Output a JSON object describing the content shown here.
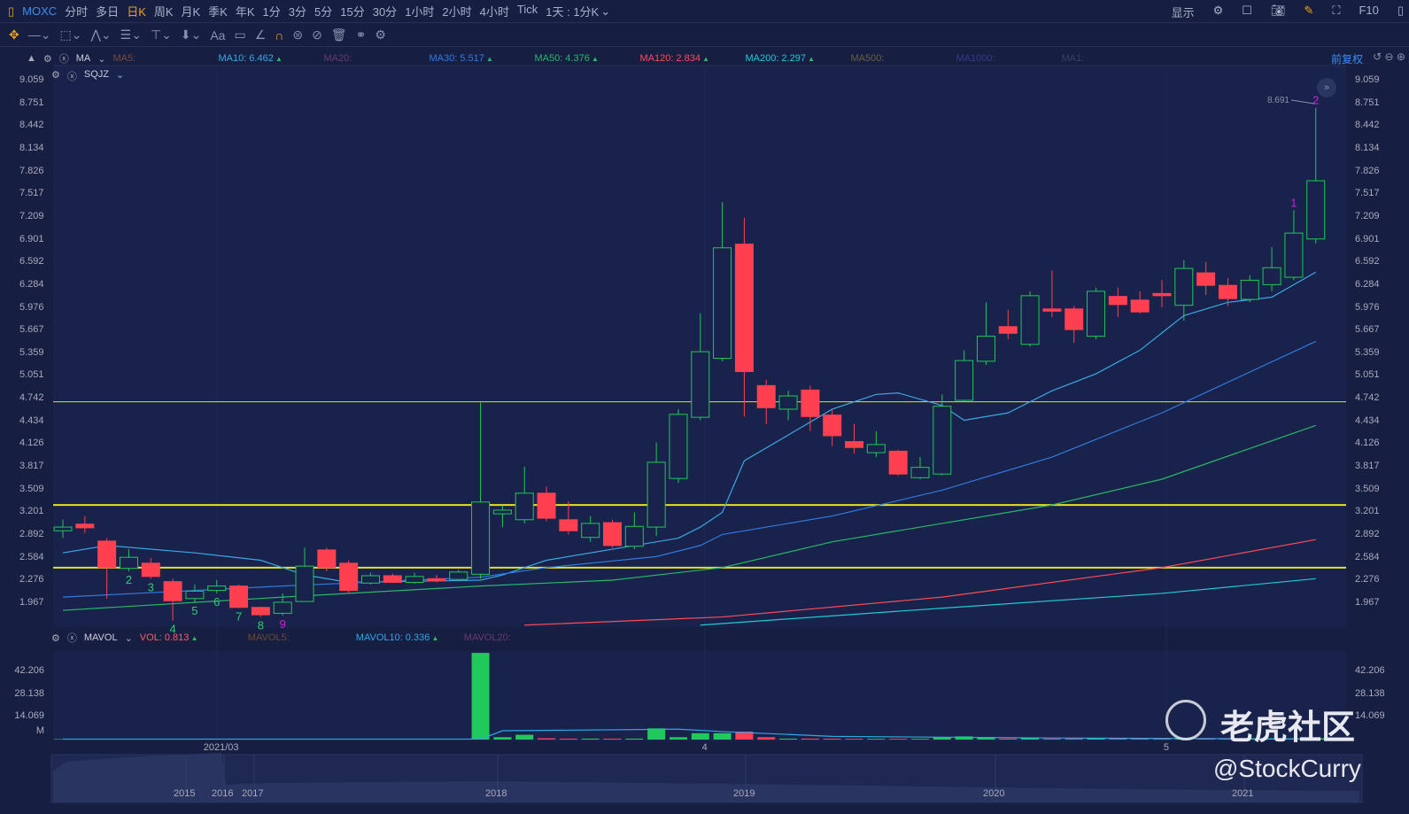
{
  "header": {
    "ticker": "MOXC",
    "periods": [
      "分时",
      "多日",
      "日K",
      "周K",
      "月K",
      "季K",
      "年K",
      "1分",
      "3分",
      "5分",
      "15分",
      "30分",
      "1小时",
      "2小时",
      "4小时",
      "Tick"
    ],
    "active_period": "日K",
    "interval": "1天 : 1分K",
    "display": "显示",
    "f10": "F10"
  },
  "toolbar": {
    "icons": [
      "move-icon",
      "line-icon",
      "rect-icon",
      "wave-icon",
      "fib-icon",
      "measure-icon",
      "arrow-down-icon",
      "text-icon",
      "comment-icon",
      "angle-icon",
      "magnet-icon",
      "lock-icon",
      "hide-icon",
      "trash-icon",
      "compare-icon",
      "settings-icon"
    ],
    "text_tool": "Aa"
  },
  "indicators": {
    "ma": {
      "name": "MA",
      "items": [
        {
          "label": "MA5:",
          "value": "",
          "color": "#7a4a3a"
        },
        {
          "label": "MA10:",
          "value": "6.462",
          "color": "#3aa8e6"
        },
        {
          "label": "MA20:",
          "value": "",
          "color": "#6a3a6a"
        },
        {
          "label": "MA30:",
          "value": "5.517",
          "color": "#2f7be0"
        },
        {
          "label": "MA50:",
          "value": "4.376",
          "color": "#27b86a"
        },
        {
          "label": "MA120:",
          "value": "2.834",
          "color": "#ff4a5a"
        },
        {
          "label": "MA200:",
          "value": "2.297",
          "color": "#22c8d8"
        },
        {
          "label": "MA500:",
          "value": "",
          "color": "#6a6040"
        },
        {
          "label": "MA1000:",
          "value": "",
          "color": "#3a3a8a"
        },
        {
          "label": "MA1:",
          "value": "",
          "color": "#3a4060"
        }
      ]
    },
    "sqjz": {
      "name": "SQJZ"
    },
    "adj": "前复权",
    "mavol": {
      "name": "MAVOL",
      "items": [
        {
          "label": "VOL:",
          "value": "0.813",
          "color": "#ff5a6a"
        },
        {
          "label": "MAVOL5:",
          "value": "",
          "color": "#6a4a3a"
        },
        {
          "label": "MAVOL10:",
          "value": "0.336",
          "color": "#2fa8e8"
        },
        {
          "label": "MAVOL20:",
          "value": "",
          "color": "#6a3a6a"
        }
      ]
    }
  },
  "price_axis": [
    "9.059",
    "8.751",
    "8.442",
    "8.134",
    "7.826",
    "7.517",
    "7.209",
    "6.901",
    "6.592",
    "6.284",
    "5.976",
    "5.667",
    "5.359",
    "5.051",
    "4.742",
    "4.434",
    "4.126",
    "3.817",
    "3.509",
    "3.201",
    "2.892",
    "2.584",
    "2.276",
    "1.967"
  ],
  "vol_axis": [
    "42.206",
    "28.138",
    "14.069",
    "M"
  ],
  "time_axis": [
    {
      "label": "2021/03",
      "i": 7
    },
    {
      "label": "4",
      "i": 29.2
    },
    {
      "label": "5",
      "i": 50.2
    }
  ],
  "navigator_years": [
    "2015",
    "2016",
    "2017",
    "2018",
    "2019",
    "2020",
    "2021"
  ],
  "high_label": "8.691",
  "watermark": "老虎社区",
  "author": "@StockCurry",
  "chart_data": {
    "type": "candlestick",
    "price_range": [
      1.967,
      9.059
    ],
    "vol_range": [
      0,
      56.27
    ],
    "candles_ochl": [
      [
        2.95,
        3.0,
        3.1,
        2.85
      ],
      [
        3.04,
        2.99,
        3.15,
        2.92
      ],
      [
        2.81,
        2.45,
        2.85,
        2.03
      ],
      [
        2.44,
        2.59,
        2.7,
        2.4
      ],
      [
        2.51,
        2.33,
        2.58,
        2.3
      ],
      [
        2.26,
        2.0,
        2.3,
        1.73
      ],
      [
        2.03,
        2.13,
        2.22,
        1.98
      ],
      [
        2.14,
        2.2,
        2.28,
        2.1
      ],
      [
        2.2,
        1.91,
        2.22,
        1.9
      ],
      [
        1.91,
        1.81,
        1.92,
        1.78
      ],
      [
        1.83,
        1.98,
        2.1,
        1.8
      ],
      [
        1.99,
        2.47,
        2.72,
        1.99
      ],
      [
        2.69,
        2.45,
        2.72,
        2.4
      ],
      [
        2.51,
        2.14,
        2.55,
        2.1
      ],
      [
        2.24,
        2.34,
        2.38,
        2.22
      ],
      [
        2.34,
        2.25,
        2.37,
        2.24
      ],
      [
        2.25,
        2.33,
        2.38,
        2.23
      ],
      [
        2.3,
        2.27,
        2.35,
        2.25
      ],
      [
        2.29,
        2.39,
        2.42,
        2.27
      ],
      [
        2.36,
        3.34,
        4.69,
        2.3
      ],
      [
        3.18,
        3.23,
        3.3,
        3.0
      ],
      [
        3.1,
        3.46,
        3.82,
        3.05
      ],
      [
        3.46,
        3.12,
        3.55,
        3.08
      ],
      [
        3.1,
        2.95,
        3.35,
        2.9
      ],
      [
        2.86,
        3.05,
        3.15,
        2.8
      ],
      [
        3.06,
        2.75,
        3.1,
        2.72
      ],
      [
        2.74,
        3.01,
        3.2,
        2.7
      ],
      [
        3.0,
        3.88,
        4.15,
        2.88
      ],
      [
        3.66,
        4.53,
        4.6,
        3.6
      ],
      [
        4.49,
        5.38,
        5.9,
        4.45
      ],
      [
        5.29,
        6.79,
        7.41,
        5.25
      ],
      [
        6.84,
        5.11,
        7.2,
        4.5
      ],
      [
        4.92,
        4.62,
        5.0,
        4.4
      ],
      [
        4.6,
        4.78,
        4.85,
        4.45
      ],
      [
        4.86,
        4.5,
        4.92,
        4.3
      ],
      [
        4.52,
        4.24,
        4.6,
        4.1
      ],
      [
        4.16,
        4.08,
        4.4,
        4.0
      ],
      [
        4.01,
        4.12,
        4.3,
        3.95
      ],
      [
        4.03,
        3.72,
        4.05,
        3.7
      ],
      [
        3.67,
        3.81,
        3.95,
        3.65
      ],
      [
        3.72,
        4.64,
        4.8,
        3.7
      ],
      [
        4.72,
        5.26,
        5.4,
        4.7
      ],
      [
        5.25,
        5.59,
        6.05,
        5.2
      ],
      [
        5.72,
        5.63,
        5.95,
        5.55
      ],
      [
        5.48,
        6.14,
        6.2,
        5.45
      ],
      [
        5.96,
        5.93,
        6.48,
        5.85
      ],
      [
        5.96,
        5.68,
        6.0,
        5.5
      ],
      [
        5.59,
        6.2,
        6.25,
        5.55
      ],
      [
        6.13,
        6.02,
        6.25,
        5.85
      ],
      [
        6.08,
        5.92,
        6.2,
        5.9
      ],
      [
        6.17,
        6.14,
        6.35,
        5.98
      ],
      [
        6.01,
        6.51,
        6.62,
        5.8
      ],
      [
        6.45,
        6.28,
        6.6,
        6.15
      ],
      [
        6.28,
        6.1,
        6.38,
        6.0
      ],
      [
        6.09,
        6.35,
        6.42,
        6.05
      ],
      [
        6.29,
        6.52,
        6.8,
        6.2
      ],
      [
        6.39,
        6.99,
        7.3,
        6.35
      ],
      [
        6.91,
        7.7,
        8.69,
        6.85
      ]
    ],
    "volume": [
      0.3,
      0.3,
      0.4,
      0.3,
      0.3,
      0.4,
      0.3,
      0.3,
      0.3,
      0.3,
      0.3,
      0.4,
      0.3,
      0.3,
      0.3,
      0.3,
      0.3,
      0.3,
      0.4,
      54,
      1.5,
      3,
      0.8,
      0.6,
      0.6,
      0.6,
      0.6,
      7,
      1.5,
      4,
      4,
      5,
      1.5,
      0.6,
      0.6,
      0.6,
      0.5,
      0.5,
      0.5,
      0.5,
      1.5,
      2,
      1.5,
      0.6,
      1.2,
      0.6,
      0.6,
      1,
      0.6,
      0.6,
      0.5,
      1,
      0.6,
      0.6,
      0.6,
      0.6,
      0.6,
      0.8
    ],
    "mavol10": [
      [
        0,
        0.3
      ],
      [
        19,
        0.3
      ],
      [
        20,
        5.5
      ],
      [
        28,
        6.5
      ],
      [
        30,
        5
      ],
      [
        35,
        2
      ],
      [
        45,
        1
      ],
      [
        57,
        0.4
      ]
    ],
    "ma_lines": [
      {
        "name": "MA10",
        "color": "#3aa8e6",
        "points": [
          [
            0,
            2.65
          ],
          [
            2,
            2.75
          ],
          [
            6,
            2.65
          ],
          [
            9,
            2.55
          ],
          [
            11,
            2.35
          ],
          [
            13,
            2.25
          ],
          [
            19,
            2.28
          ],
          [
            20,
            2.35
          ],
          [
            22,
            2.55
          ],
          [
            25,
            2.7
          ],
          [
            28,
            2.85
          ],
          [
            29,
            3.0
          ],
          [
            30,
            3.2
          ],
          [
            31,
            3.9
          ],
          [
            33,
            4.25
          ],
          [
            35,
            4.6
          ],
          [
            37,
            4.8
          ],
          [
            38,
            4.82
          ],
          [
            40,
            4.65
          ],
          [
            41,
            4.45
          ],
          [
            43,
            4.55
          ],
          [
            45,
            4.85
          ],
          [
            47,
            5.08
          ],
          [
            49,
            5.4
          ],
          [
            51,
            5.87
          ],
          [
            53,
            6.05
          ],
          [
            55,
            6.12
          ],
          [
            57,
            6.46
          ]
        ]
      },
      {
        "name": "MA30",
        "color": "#2f7be0",
        "points": [
          [
            0,
            2.05
          ],
          [
            10,
            2.2
          ],
          [
            19,
            2.32
          ],
          [
            22,
            2.45
          ],
          [
            27,
            2.6
          ],
          [
            29,
            2.75
          ],
          [
            30,
            2.9
          ],
          [
            35,
            3.15
          ],
          [
            40,
            3.5
          ],
          [
            45,
            3.95
          ],
          [
            50,
            4.55
          ],
          [
            57,
            5.52
          ]
        ]
      },
      {
        "name": "MA50",
        "color": "#27b86a",
        "points": [
          [
            0,
            1.87
          ],
          [
            10,
            2.05
          ],
          [
            19,
            2.2
          ],
          [
            25,
            2.28
          ],
          [
            30,
            2.45
          ],
          [
            35,
            2.8
          ],
          [
            40,
            3.05
          ],
          [
            45,
            3.3
          ],
          [
            50,
            3.65
          ],
          [
            57,
            4.38
          ]
        ]
      },
      {
        "name": "MA120",
        "color": "#ff4a5a",
        "points": [
          [
            21,
            1.67
          ],
          [
            30,
            1.78
          ],
          [
            40,
            2.05
          ],
          [
            50,
            2.45
          ],
          [
            57,
            2.83
          ]
        ]
      },
      {
        "name": "MA200",
        "color": "#22c8d8",
        "points": [
          [
            29,
            1.67
          ],
          [
            40,
            1.9
          ],
          [
            50,
            2.1
          ],
          [
            57,
            2.3
          ]
        ]
      }
    ],
    "hlines": [
      {
        "price": 4.7,
        "width": 1
      },
      {
        "price": 3.3,
        "width": 2
      },
      {
        "price": 2.45,
        "width": 2
      }
    ],
    "hline_color": "#e8e020",
    "td_labels": [
      {
        "i": 3,
        "text": "2",
        "pos": "below",
        "color": "#2ecc71"
      },
      {
        "i": 4,
        "text": "3",
        "pos": "below",
        "color": "#2ecc71"
      },
      {
        "i": 5,
        "text": "4",
        "pos": "below",
        "color": "#2ecc71"
      },
      {
        "i": 6,
        "text": "5",
        "pos": "below",
        "color": "#2ecc71"
      },
      {
        "i": 7,
        "text": "6",
        "pos": "below",
        "color": "#2ecc71"
      },
      {
        "i": 8,
        "text": "7",
        "pos": "below",
        "color": "#2ecc71"
      },
      {
        "i": 9,
        "text": "8",
        "pos": "below",
        "color": "#2ecc71"
      },
      {
        "i": 10,
        "text": "9",
        "pos": "below",
        "color": "#d020e0"
      },
      {
        "i": 56,
        "text": "1",
        "pos": "above",
        "color": "#d020e0"
      },
      {
        "i": 57,
        "text": "2",
        "pos": "above",
        "color": "#d020e0"
      }
    ],
    "up_color": "#1fc95a",
    "down_color": "#ff4050"
  }
}
